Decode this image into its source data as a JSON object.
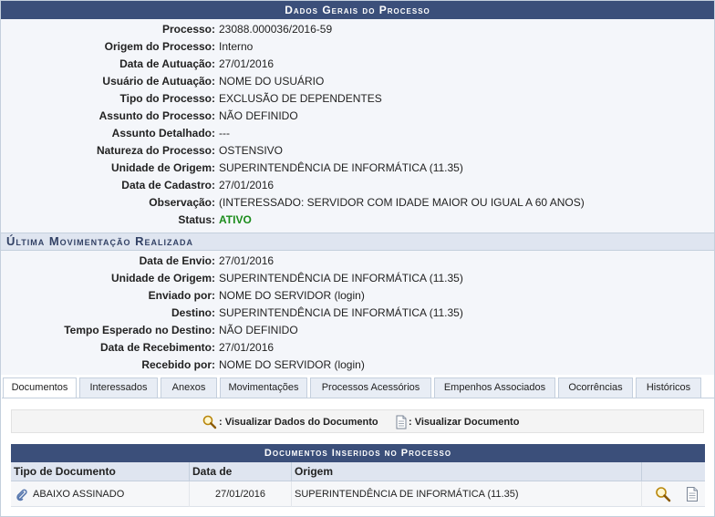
{
  "main_header": "Dados Gerais do Processo",
  "general_info": [
    {
      "label": "Processo:",
      "value": "23088.000036/2016-59"
    },
    {
      "label": "Origem do Processo:",
      "value": "Interno"
    },
    {
      "label": "Data de Autuação:",
      "value": "27/01/2016"
    },
    {
      "label": "Usuário de Autuação:",
      "value": "NOME DO USUÁRIO"
    },
    {
      "label": "Tipo do Processo:",
      "value": "EXCLUSÃO DE DEPENDENTES"
    },
    {
      "label": "Assunto do Processo:",
      "value": "NÃO DEFINIDO"
    },
    {
      "label": "Assunto Detalhado:",
      "value": "---"
    },
    {
      "label": "Natureza do Processo:",
      "value": "OSTENSIVO"
    },
    {
      "label": "Unidade de Origem:",
      "value": "SUPERINTENDÊNCIA DE INFORMÁTICA (11.35)"
    },
    {
      "label": "Data de Cadastro:",
      "value": "27/01/2016"
    },
    {
      "label": "Observação:",
      "value": "(INTERESSADO: SERVIDOR COM IDADE MAIOR OU IGUAL A 60 ANOS)"
    },
    {
      "label": "Status:",
      "value": "ATIVO"
    }
  ],
  "status_color": "#1b8c1b",
  "last_movement_header": "Última Movimentação Realizada",
  "last_movement": [
    {
      "label": "Data de Envio:",
      "value": "27/01/2016"
    },
    {
      "label": "Unidade de Origem:",
      "value": "SUPERINTENDÊNCIA DE INFORMÁTICA (11.35)"
    },
    {
      "label": "Enviado por:",
      "value": "NOME DO SERVIDOR (login)"
    },
    {
      "label": "Destino:",
      "value": "SUPERINTENDÊNCIA DE INFORMÁTICA (11.35)"
    },
    {
      "label": "Tempo Esperado no Destino:",
      "value": "NÃO DEFINIDO"
    },
    {
      "label": "Data de Recebimento:",
      "value": "27/01/2016"
    },
    {
      "label": "Recebido por:",
      "value": "NOME DO SERVIDOR (login)"
    }
  ],
  "tabs": [
    {
      "label": "Documentos",
      "active": true
    },
    {
      "label": "Interessados"
    },
    {
      "label": "Anexos"
    },
    {
      "label": "Movimentações"
    },
    {
      "label": "Processos Acessórios"
    },
    {
      "label": "Empenhos Associados"
    },
    {
      "label": "Ocorrências"
    },
    {
      "label": "Históricos"
    }
  ],
  "legend": {
    "view_data_label": ": Visualizar Dados do Documento",
    "view_doc_label": ": Visualizar Documento",
    "view_data_icon": "magnifier-icon",
    "view_doc_icon": "document-icon"
  },
  "documents": {
    "header": "Documentos Inseridos no Processo",
    "columns": [
      "Tipo de Documento",
      "Data de Documento",
      "Origem"
    ],
    "rows": [
      {
        "tipo": "ABAIXO ASSINADO",
        "data": "27/01/2016",
        "origem": "SUPERINTENDÊNCIA DE INFORMÁTICA (11.35)",
        "type_icon": "paperclip-icon"
      }
    ]
  },
  "colors": {
    "header_bg": "#3b4f7a",
    "subheader_bg": "#dfe5f0",
    "panel_bg": "#f4f6fa"
  }
}
